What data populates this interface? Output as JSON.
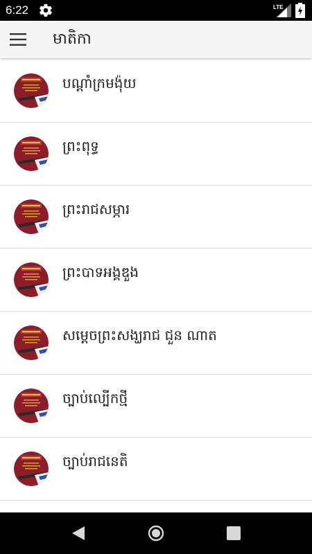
{
  "status_bar": {
    "time": "6:22",
    "network_label": "LTE",
    "icons": [
      "gear-icon",
      "signal-icon",
      "battery-icon"
    ]
  },
  "app_bar": {
    "title": "មាតិកា",
    "menu_icon": "hamburger-icon"
  },
  "list": {
    "items": [
      {
        "label": "បណ្តាំក្រមង៉ុយ"
      },
      {
        "label": "ព្រះពុទ្ធ"
      },
      {
        "label": "ព្រះរាជសម្ភារ"
      },
      {
        "label": "ព្រះបាទអង្គឌួង"
      },
      {
        "label": "សម្តេចព្រះសង្ឃរាជ ជួន ណាត"
      },
      {
        "label": "ច្បាប់ល្បើកថ្មី"
      },
      {
        "label": "ច្បាប់រាជនេតិ"
      }
    ]
  },
  "nav_bar": {
    "icons": [
      "back-icon",
      "home-icon",
      "recent-apps-icon"
    ]
  },
  "colors": {
    "status_bar": "#000000",
    "app_bar": "#f5f5f5",
    "avatar_maroon": "#8b1e2a",
    "divider": "#dcdcdc"
  }
}
